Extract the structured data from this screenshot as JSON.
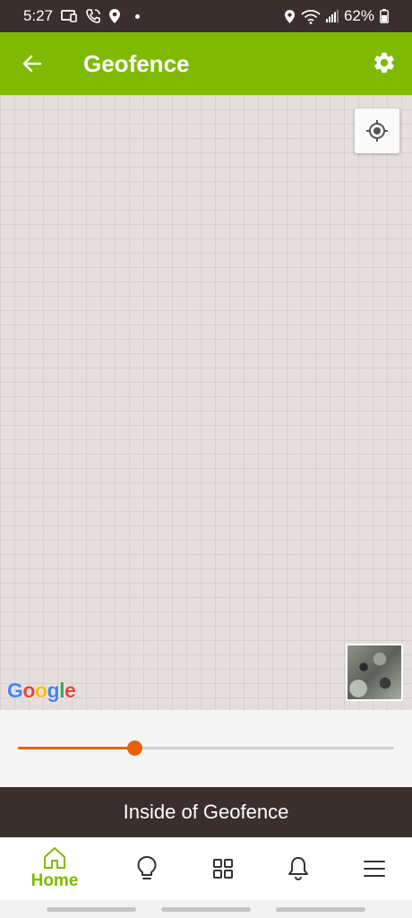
{
  "status_bar": {
    "time": "5:27",
    "battery": "62%",
    "icons_left": [
      "cast-icon",
      "call-icon",
      "location-pin-icon"
    ],
    "icons_right": [
      "location-icon",
      "wifi-icon",
      "signal-icon",
      "battery-icon"
    ]
  },
  "app_bar": {
    "title": "Geofence",
    "background": "#7fba00"
  },
  "map": {
    "attribution": "Google"
  },
  "slider": {
    "value_fraction": 0.31,
    "accent": "#e8620e"
  },
  "banner": {
    "text": "Inside of Geofence"
  },
  "bottom_nav": {
    "items": [
      {
        "label": "Home",
        "icon": "home-icon",
        "active": true
      },
      {
        "label": "",
        "icon": "lightbulb-icon"
      },
      {
        "label": "",
        "icon": "grid-icon"
      },
      {
        "label": "",
        "icon": "bell-icon"
      },
      {
        "label": "",
        "icon": "menu-icon"
      }
    ],
    "active_color": "#7fba00"
  }
}
